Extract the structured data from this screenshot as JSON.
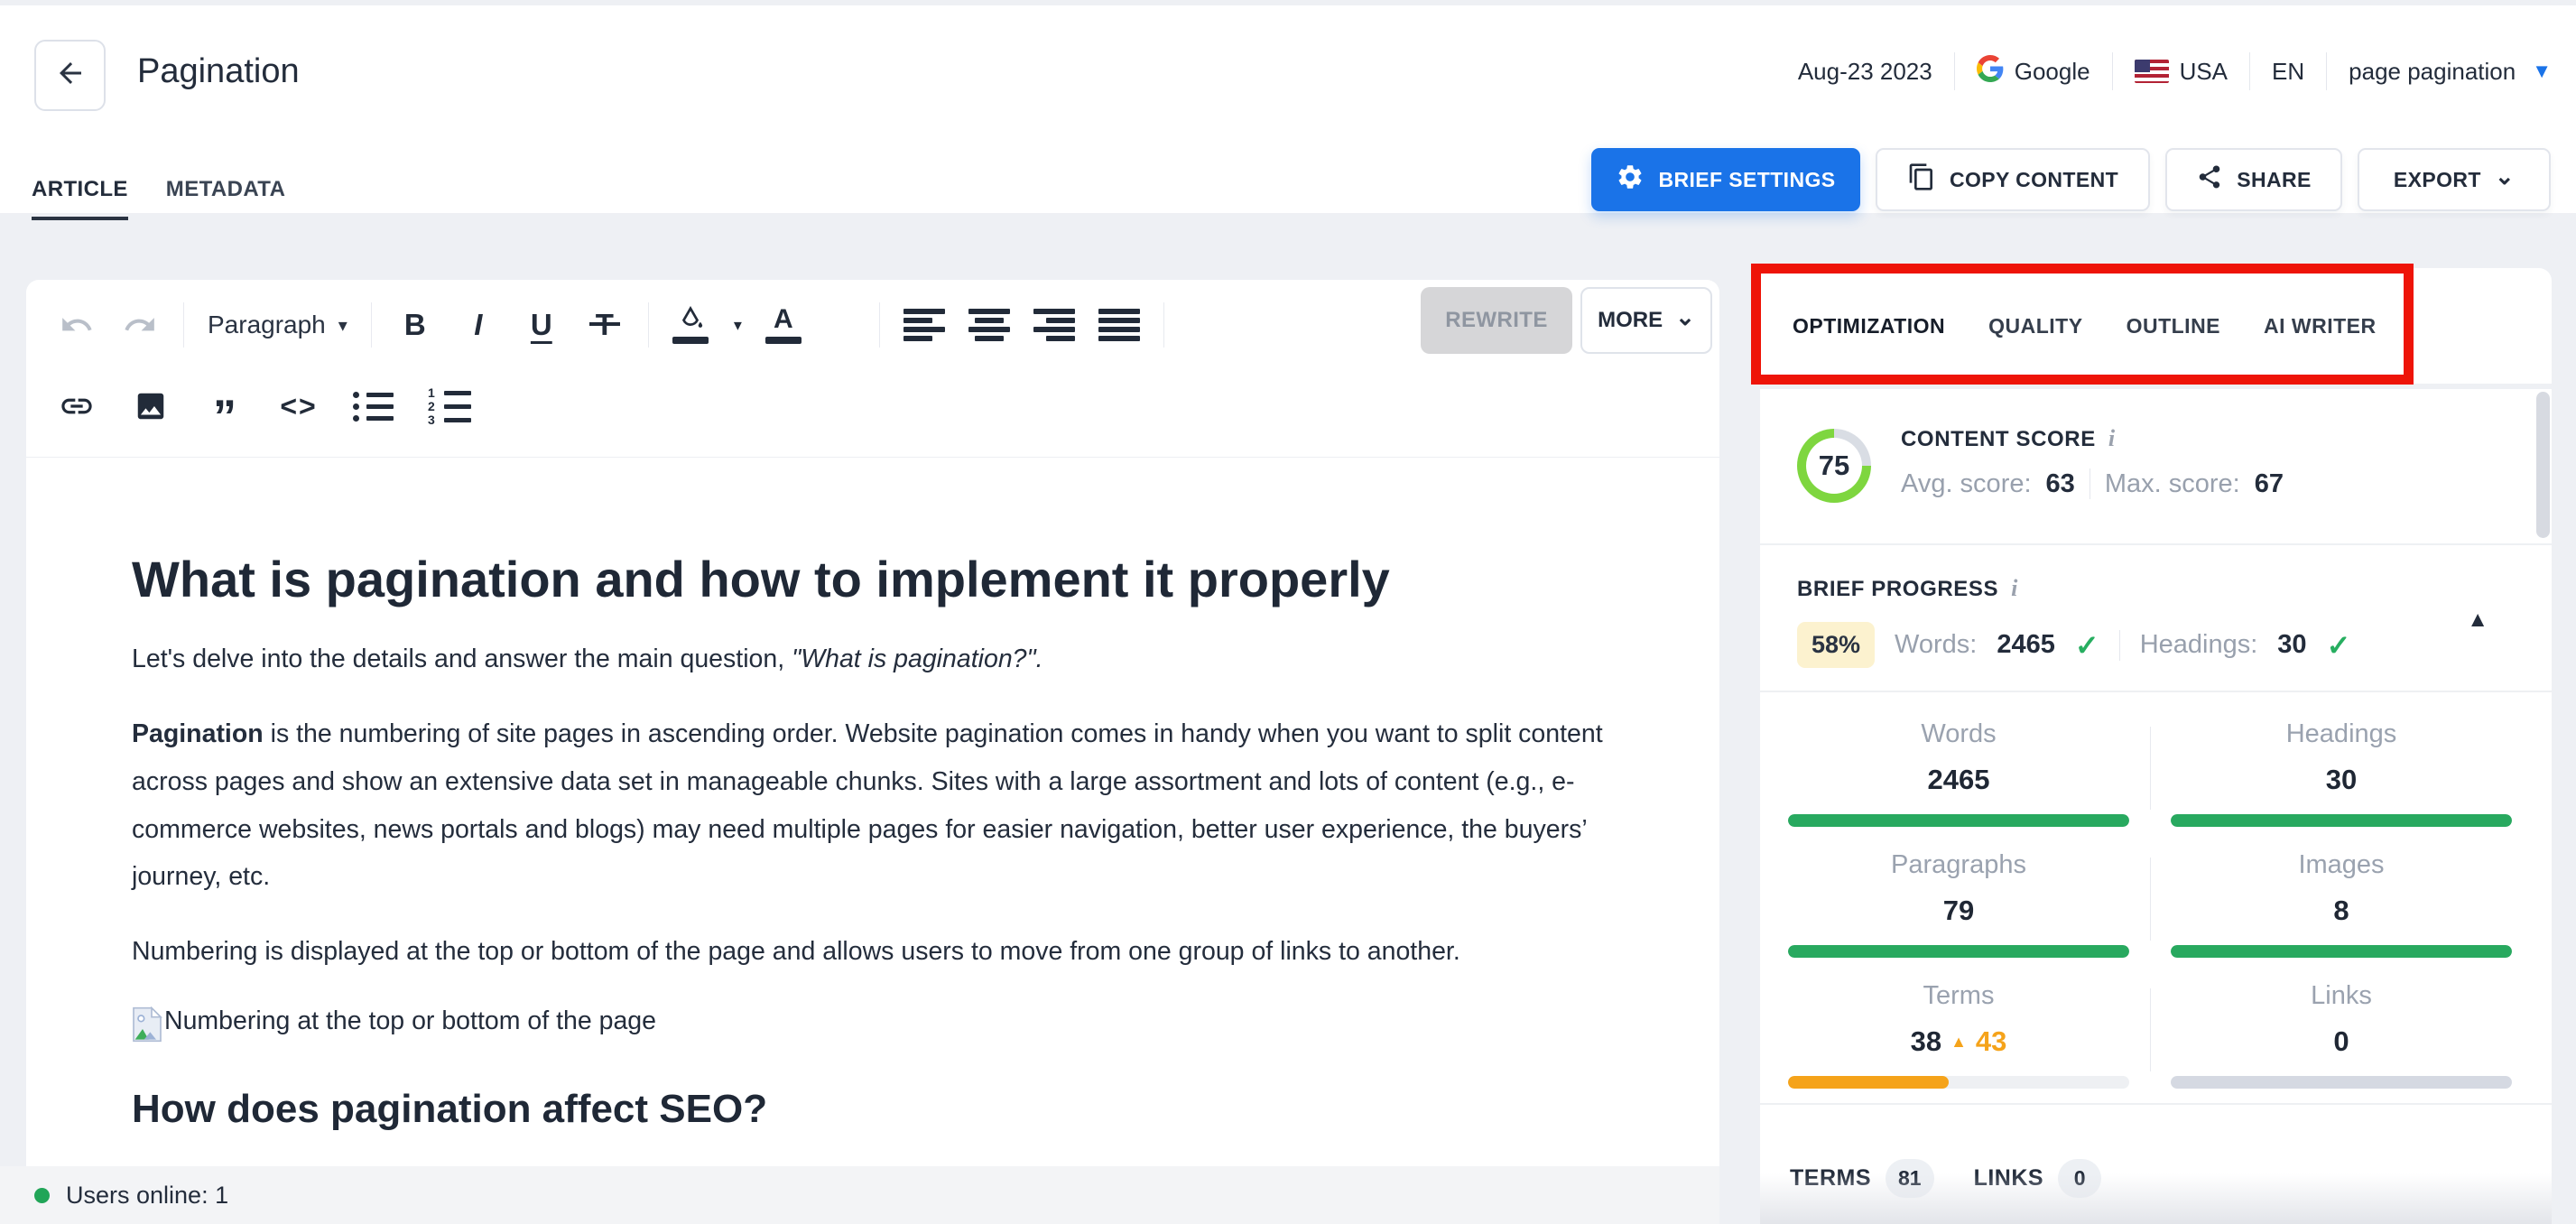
{
  "header": {
    "title": "Pagination",
    "date": "Aug-23 2023",
    "search_engine": "Google",
    "country": "USA",
    "language": "EN",
    "keyword": "page pagination",
    "tabs": [
      {
        "label": "ARTICLE"
      },
      {
        "label": "METADATA"
      }
    ],
    "buttons": {
      "brief_settings": "BRIEF SETTINGS",
      "copy_content": "COPY CONTENT",
      "share": "SHARE",
      "export": "EXPORT"
    }
  },
  "toolbar": {
    "paragraph_label": "Paragraph",
    "bold": "B",
    "italic": "I",
    "underline": "U",
    "strikethrough": "T",
    "text_color_letter": "A",
    "rewrite_label": "REWRITE",
    "more_label": "MORE"
  },
  "icons": {
    "check": "✓",
    "caret_down": "▾",
    "triangle_down": "▼",
    "triangle_up_small": "▲",
    "collapse_up": "▲",
    "chevron_down": "⌄",
    "quote": "”",
    "code": "<>"
  },
  "article": {
    "h1": "What is pagination and how to implement it properly",
    "intro_prefix": "Let's delve into the details and answer the main question, ",
    "intro_quote": "\"What is pagination?\".",
    "p1_bold": "Pagination",
    "p1_rest": " is the numbering of site pages in ascending order. Website pagination comes in handy when you want to split content across pages and show an extensive data set in manageable chunks. Sites with a large assortment and lots of content (e.g., e-commerce websites, news portals and blogs) may need multiple pages for easier navigation, better user experience, the buyers’ journey, etc.",
    "p2": "Numbering is displayed at the top or bottom of the page and allows users to move from one group of links to another.",
    "image_alt": "Numbering at the top or bottom of the page",
    "h2": "How does pagination affect SEO?"
  },
  "status_bar": {
    "users_online": "Users online: 1"
  },
  "panel": {
    "tabs": [
      {
        "label": "OPTIMIZATION"
      },
      {
        "label": "QUALITY"
      },
      {
        "label": "OUTLINE"
      },
      {
        "label": "AI WRITER"
      }
    ],
    "content_score": {
      "label": "CONTENT SCORE",
      "info": "i",
      "score": "75",
      "avg_label": "Avg. score:",
      "avg": "63",
      "max_label": "Max. score:",
      "max": "67"
    },
    "brief_progress": {
      "label": "BRIEF PROGRESS",
      "info": "i",
      "percent": "58%",
      "words_label": "Words:",
      "words": "2465",
      "headings_label": "Headings:",
      "headings": "30"
    },
    "stats": [
      {
        "label": "Words",
        "value": "2465",
        "bar_pct": 100,
        "bar_color": "green"
      },
      {
        "label": "Headings",
        "value": "30",
        "bar_pct": 100,
        "bar_color": "green"
      },
      {
        "label": "Paragraphs",
        "value": "79",
        "bar_pct": 100,
        "bar_color": "green"
      },
      {
        "label": "Images",
        "value": "8",
        "bar_pct": 100,
        "bar_color": "green"
      },
      {
        "label": "Terms",
        "value": "38",
        "target": "43",
        "bar_pct": 47,
        "bar_color": "orange"
      },
      {
        "label": "Links",
        "value": "0",
        "bar_pct": 100,
        "bar_color": "gray"
      }
    ],
    "footer": {
      "terms_label": "TERMS",
      "terms_count": "81",
      "links_label": "LINKS",
      "links_count": "0"
    }
  },
  "colors": {
    "accent_blue": "#1a73e8",
    "green": "#28a95f",
    "score_lime": "#7ed63f",
    "orange": "#f5a31a",
    "gray": "#d5d9e2",
    "annotation_red": "#ee1408",
    "badge_yellow_bg": "#fcf2cf"
  }
}
